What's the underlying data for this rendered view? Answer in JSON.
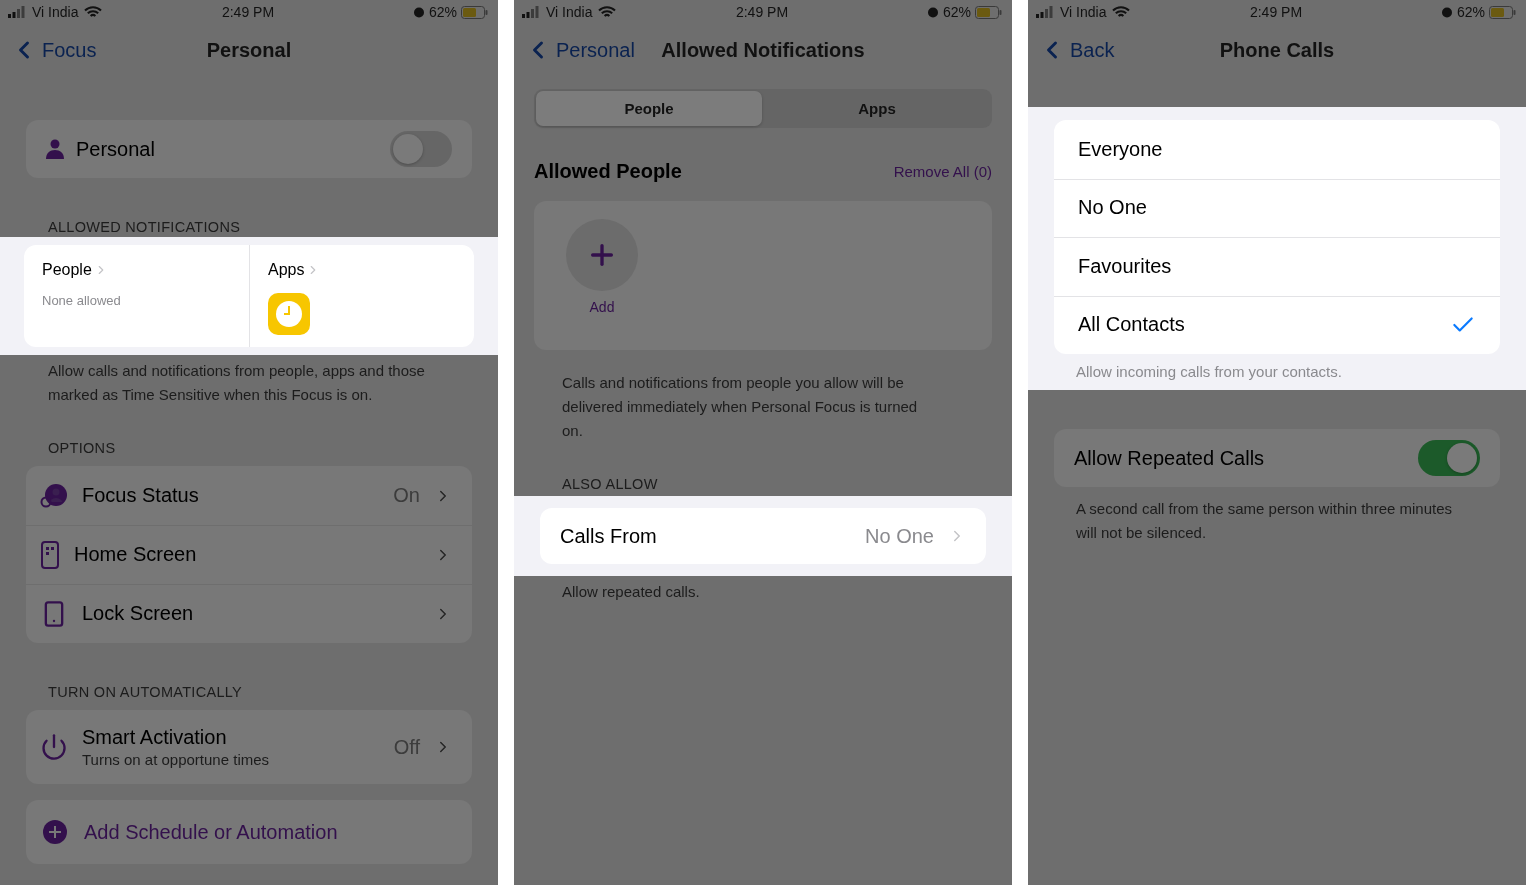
{
  "screens": [
    {
      "status": {
        "carrier": "Vi India",
        "time": "2:49 PM",
        "battery": "62%"
      },
      "nav": {
        "back": "Focus",
        "title": "Personal"
      },
      "sections": [
        {
          "kind": "toggle_card",
          "highlighted": false,
          "label": "Personal",
          "on": false
        },
        {
          "kind": "header",
          "highlighted": false,
          "text": "ALLOWED NOTIFICATIONS"
        },
        {
          "kind": "tiles",
          "highlighted": true,
          "tiles": [
            {
              "title": "People",
              "subtitle": "None allowed"
            },
            {
              "title": "Apps"
            }
          ]
        },
        {
          "kind": "footer",
          "highlighted": false,
          "text": "Allow calls and notifications from people, apps and those marked as Time Sensitive when this Focus is on."
        },
        {
          "kind": "header",
          "highlighted": false,
          "text": "OPTIONS"
        },
        {
          "kind": "list",
          "highlighted": false,
          "rows": [
            {
              "label": "Focus Status",
              "value": "On"
            },
            {
              "label": "Home Screen"
            },
            {
              "label": "Lock Screen"
            }
          ]
        },
        {
          "kind": "header",
          "highlighted": false,
          "text": "TURN ON AUTOMATICALLY"
        },
        {
          "kind": "list",
          "highlighted": false,
          "rows": [
            {
              "label": "Smart Activation",
              "subtitle": "Turns on at opportune times",
              "value": "Off"
            }
          ]
        },
        {
          "kind": "action",
          "highlighted": false,
          "label": "Add Schedule or Automation"
        }
      ]
    },
    {
      "status": {
        "carrier": "Vi India",
        "time": "2:49 PM",
        "battery": "62%"
      },
      "nav": {
        "back": "Personal",
        "title": "Allowed Notifications"
      },
      "sections": [
        {
          "kind": "segmented",
          "highlighted": false,
          "tabs": [
            {
              "label": "People",
              "selected": true
            },
            {
              "label": "Apps",
              "selected": false
            }
          ]
        },
        {
          "kind": "title_row",
          "highlighted": false,
          "title": "Allowed People",
          "action": "Remove All (0)"
        },
        {
          "kind": "add_card",
          "highlighted": false,
          "label": "Add"
        },
        {
          "kind": "footer",
          "highlighted": false,
          "text": "Calls and notifications from people you allow will be delivered immediately when Personal Focus is turned on."
        },
        {
          "kind": "header",
          "highlighted": false,
          "text": "ALSO ALLOW"
        },
        {
          "kind": "list",
          "highlighted": true,
          "rows": [
            {
              "label": "Calls From",
              "value": "No One"
            }
          ]
        },
        {
          "kind": "footer",
          "highlighted": false,
          "text": "Allow repeated calls."
        }
      ]
    },
    {
      "status": {
        "carrier": "Vi India",
        "time": "2:49 PM",
        "battery": "62%"
      },
      "nav": {
        "back": "Back",
        "title": "Phone Calls"
      },
      "sections": [
        {
          "kind": "choice_list",
          "highlighted": true,
          "options": [
            {
              "label": "Everyone",
              "selected": false
            },
            {
              "label": "No One",
              "selected": false
            },
            {
              "label": "Favourites",
              "selected": false
            },
            {
              "label": "All Contacts",
              "selected": true
            }
          ]
        },
        {
          "kind": "footer",
          "highlighted": true,
          "text": "Allow incoming calls from your contacts."
        },
        {
          "kind": "toggle_card",
          "highlighted": false,
          "label": "Allow Repeated Calls",
          "on": true
        },
        {
          "kind": "footer",
          "highlighted": false,
          "text": "A second call from the same person within three minutes will not be silenced."
        }
      ]
    }
  ]
}
